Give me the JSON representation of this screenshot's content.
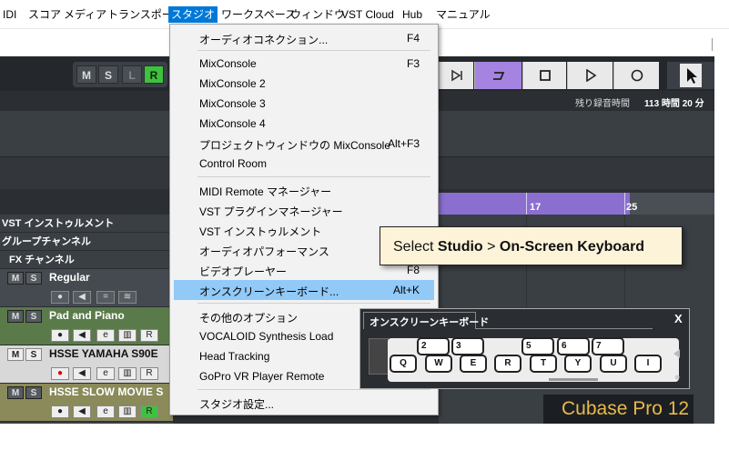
{
  "menubar": {
    "items": [
      "IDI",
      "スコア",
      "メディア",
      "トランスポート",
      "スタジオ",
      "ワークスペース",
      "ウィンドウ",
      "VST Cloud",
      "Hub",
      "マニュアル"
    ],
    "active": "スタジオ"
  },
  "transport": {
    "ms_buttons": [
      "M",
      "S",
      "L",
      "R"
    ],
    "remaining_label": "残り録音時間",
    "remaining_value": "113 時間 20 分"
  },
  "ruler": {
    "labels": [
      "17",
      "25"
    ]
  },
  "tracks": {
    "folders": [
      "VST インストゥルメント",
      "グループチャンネル",
      "FX チャンネル"
    ],
    "items": [
      {
        "name": "Regular"
      },
      {
        "name": "Pad and Piano"
      },
      {
        "name": "HSSE YAMAHA S90E"
      },
      {
        "name": "HSSE SLOW MOVIE S"
      }
    ],
    "m": "M",
    "s": "S",
    "r": "R",
    "e": "e"
  },
  "studio_menu": {
    "items": [
      {
        "label": "オーディオコネクション...",
        "shortcut": "F4"
      },
      {
        "label": "MixConsole",
        "shortcut": "F3"
      },
      {
        "label": "MixConsole 2",
        "shortcut": ""
      },
      {
        "label": "MixConsole 3",
        "shortcut": ""
      },
      {
        "label": "MixConsole 4",
        "shortcut": ""
      },
      {
        "label": "プロジェクトウィンドウの MixConsole",
        "shortcut": "Alt+F3"
      },
      {
        "label": "Control Room",
        "shortcut": ""
      },
      {
        "label": "MIDI Remote マネージャー",
        "shortcut": ""
      },
      {
        "label": "VST プラグインマネージャー",
        "shortcut": ""
      },
      {
        "label": "VST インストゥルメント",
        "shortcut": ""
      },
      {
        "label": "オーディオパフォーマンス",
        "shortcut": ""
      },
      {
        "label": "ビデオプレーヤー",
        "shortcut": "F8"
      },
      {
        "label": "オンスクリーンキーボード...",
        "shortcut": "Alt+K"
      },
      {
        "label": "その他のオプション",
        "shortcut": ""
      },
      {
        "label": "VOCALOID Synthesis Load",
        "shortcut": ""
      },
      {
        "label": "Head Tracking",
        "shortcut": ""
      },
      {
        "label": "GoPro VR Player Remote",
        "shortcut": ""
      },
      {
        "label": "スタジオ設定...",
        "shortcut": ""
      }
    ],
    "highlighted": "オンスクリーンキーボード..."
  },
  "callout": {
    "prefix": "Select ",
    "bold1": "Studio",
    "sep": " > ",
    "bold2": "On-Screen Keyboard"
  },
  "onscreen_keyboard": {
    "title": "オンスクリーンキーボード",
    "close": "X",
    "white_keys": [
      "Q",
      "W",
      "E",
      "R",
      "T",
      "Y",
      "U",
      "I"
    ],
    "black_keys": [
      "2",
      "3",
      "5",
      "6",
      "7"
    ]
  },
  "brand": "Cubase Pro 12",
  "colors": {
    "menu_active": "#0078d7",
    "menu_highlight": "#91c9f7",
    "cycle": "#a484e0",
    "record_green": "#3ec13e",
    "brand_text": "#e9b94a"
  }
}
